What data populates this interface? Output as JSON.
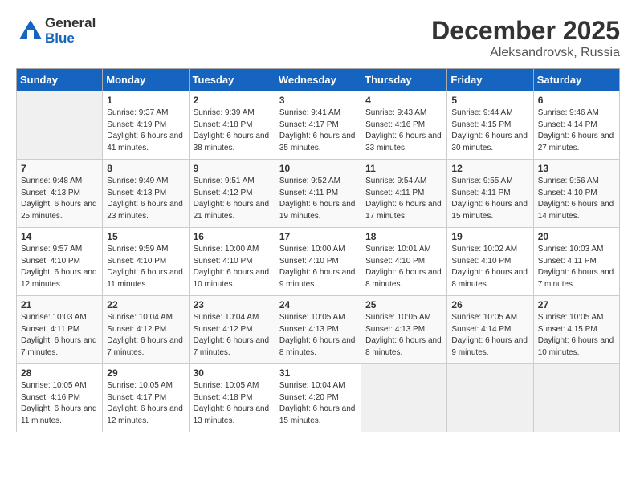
{
  "header": {
    "logo_general": "General",
    "logo_blue": "Blue",
    "month": "December 2025",
    "location": "Aleksandrovsk, Russia"
  },
  "weekdays": [
    "Sunday",
    "Monday",
    "Tuesday",
    "Wednesday",
    "Thursday",
    "Friday",
    "Saturday"
  ],
  "weeks": [
    [
      {
        "day": "",
        "sunrise": "",
        "sunset": "",
        "daylight": ""
      },
      {
        "day": "1",
        "sunrise": "Sunrise: 9:37 AM",
        "sunset": "Sunset: 4:19 PM",
        "daylight": "Daylight: 6 hours and 41 minutes."
      },
      {
        "day": "2",
        "sunrise": "Sunrise: 9:39 AM",
        "sunset": "Sunset: 4:18 PM",
        "daylight": "Daylight: 6 hours and 38 minutes."
      },
      {
        "day": "3",
        "sunrise": "Sunrise: 9:41 AM",
        "sunset": "Sunset: 4:17 PM",
        "daylight": "Daylight: 6 hours and 35 minutes."
      },
      {
        "day": "4",
        "sunrise": "Sunrise: 9:43 AM",
        "sunset": "Sunset: 4:16 PM",
        "daylight": "Daylight: 6 hours and 33 minutes."
      },
      {
        "day": "5",
        "sunrise": "Sunrise: 9:44 AM",
        "sunset": "Sunset: 4:15 PM",
        "daylight": "Daylight: 6 hours and 30 minutes."
      },
      {
        "day": "6",
        "sunrise": "Sunrise: 9:46 AM",
        "sunset": "Sunset: 4:14 PM",
        "daylight": "Daylight: 6 hours and 27 minutes."
      }
    ],
    [
      {
        "day": "7",
        "sunrise": "Sunrise: 9:48 AM",
        "sunset": "Sunset: 4:13 PM",
        "daylight": "Daylight: 6 hours and 25 minutes."
      },
      {
        "day": "8",
        "sunrise": "Sunrise: 9:49 AM",
        "sunset": "Sunset: 4:13 PM",
        "daylight": "Daylight: 6 hours and 23 minutes."
      },
      {
        "day": "9",
        "sunrise": "Sunrise: 9:51 AM",
        "sunset": "Sunset: 4:12 PM",
        "daylight": "Daylight: 6 hours and 21 minutes."
      },
      {
        "day": "10",
        "sunrise": "Sunrise: 9:52 AM",
        "sunset": "Sunset: 4:11 PM",
        "daylight": "Daylight: 6 hours and 19 minutes."
      },
      {
        "day": "11",
        "sunrise": "Sunrise: 9:54 AM",
        "sunset": "Sunset: 4:11 PM",
        "daylight": "Daylight: 6 hours and 17 minutes."
      },
      {
        "day": "12",
        "sunrise": "Sunrise: 9:55 AM",
        "sunset": "Sunset: 4:11 PM",
        "daylight": "Daylight: 6 hours and 15 minutes."
      },
      {
        "day": "13",
        "sunrise": "Sunrise: 9:56 AM",
        "sunset": "Sunset: 4:10 PM",
        "daylight": "Daylight: 6 hours and 14 minutes."
      }
    ],
    [
      {
        "day": "14",
        "sunrise": "Sunrise: 9:57 AM",
        "sunset": "Sunset: 4:10 PM",
        "daylight": "Daylight: 6 hours and 12 minutes."
      },
      {
        "day": "15",
        "sunrise": "Sunrise: 9:59 AM",
        "sunset": "Sunset: 4:10 PM",
        "daylight": "Daylight: 6 hours and 11 minutes."
      },
      {
        "day": "16",
        "sunrise": "Sunrise: 10:00 AM",
        "sunset": "Sunset: 4:10 PM",
        "daylight": "Daylight: 6 hours and 10 minutes."
      },
      {
        "day": "17",
        "sunrise": "Sunrise: 10:00 AM",
        "sunset": "Sunset: 4:10 PM",
        "daylight": "Daylight: 6 hours and 9 minutes."
      },
      {
        "day": "18",
        "sunrise": "Sunrise: 10:01 AM",
        "sunset": "Sunset: 4:10 PM",
        "daylight": "Daylight: 6 hours and 8 minutes."
      },
      {
        "day": "19",
        "sunrise": "Sunrise: 10:02 AM",
        "sunset": "Sunset: 4:10 PM",
        "daylight": "Daylight: 6 hours and 8 minutes."
      },
      {
        "day": "20",
        "sunrise": "Sunrise: 10:03 AM",
        "sunset": "Sunset: 4:11 PM",
        "daylight": "Daylight: 6 hours and 7 minutes."
      }
    ],
    [
      {
        "day": "21",
        "sunrise": "Sunrise: 10:03 AM",
        "sunset": "Sunset: 4:11 PM",
        "daylight": "Daylight: 6 hours and 7 minutes."
      },
      {
        "day": "22",
        "sunrise": "Sunrise: 10:04 AM",
        "sunset": "Sunset: 4:12 PM",
        "daylight": "Daylight: 6 hours and 7 minutes."
      },
      {
        "day": "23",
        "sunrise": "Sunrise: 10:04 AM",
        "sunset": "Sunset: 4:12 PM",
        "daylight": "Daylight: 6 hours and 7 minutes."
      },
      {
        "day": "24",
        "sunrise": "Sunrise: 10:05 AM",
        "sunset": "Sunset: 4:13 PM",
        "daylight": "Daylight: 6 hours and 8 minutes."
      },
      {
        "day": "25",
        "sunrise": "Sunrise: 10:05 AM",
        "sunset": "Sunset: 4:13 PM",
        "daylight": "Daylight: 6 hours and 8 minutes."
      },
      {
        "day": "26",
        "sunrise": "Sunrise: 10:05 AM",
        "sunset": "Sunset: 4:14 PM",
        "daylight": "Daylight: 6 hours and 9 minutes."
      },
      {
        "day": "27",
        "sunrise": "Sunrise: 10:05 AM",
        "sunset": "Sunset: 4:15 PM",
        "daylight": "Daylight: 6 hours and 10 minutes."
      }
    ],
    [
      {
        "day": "28",
        "sunrise": "Sunrise: 10:05 AM",
        "sunset": "Sunset: 4:16 PM",
        "daylight": "Daylight: 6 hours and 11 minutes."
      },
      {
        "day": "29",
        "sunrise": "Sunrise: 10:05 AM",
        "sunset": "Sunset: 4:17 PM",
        "daylight": "Daylight: 6 hours and 12 minutes."
      },
      {
        "day": "30",
        "sunrise": "Sunrise: 10:05 AM",
        "sunset": "Sunset: 4:18 PM",
        "daylight": "Daylight: 6 hours and 13 minutes."
      },
      {
        "day": "31",
        "sunrise": "Sunrise: 10:04 AM",
        "sunset": "Sunset: 4:20 PM",
        "daylight": "Daylight: 6 hours and 15 minutes."
      },
      {
        "day": "",
        "sunrise": "",
        "sunset": "",
        "daylight": ""
      },
      {
        "day": "",
        "sunrise": "",
        "sunset": "",
        "daylight": ""
      },
      {
        "day": "",
        "sunrise": "",
        "sunset": "",
        "daylight": ""
      }
    ]
  ]
}
